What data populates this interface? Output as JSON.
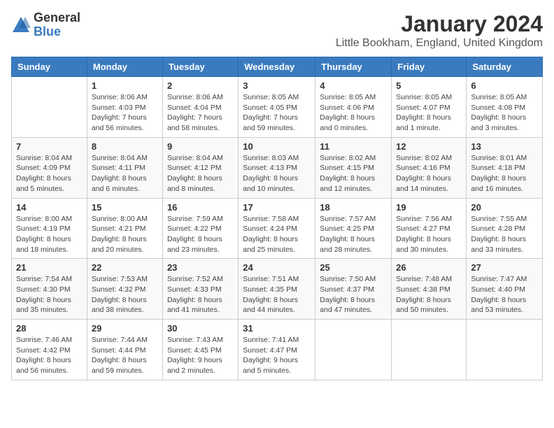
{
  "logo": {
    "general": "General",
    "blue": "Blue"
  },
  "title": {
    "month": "January 2024",
    "location": "Little Bookham, England, United Kingdom"
  },
  "headers": [
    "Sunday",
    "Monday",
    "Tuesday",
    "Wednesday",
    "Thursday",
    "Friday",
    "Saturday"
  ],
  "weeks": [
    [
      {
        "day": "",
        "detail": ""
      },
      {
        "day": "1",
        "detail": "Sunrise: 8:06 AM\nSunset: 4:03 PM\nDaylight: 7 hours\nand 56 minutes."
      },
      {
        "day": "2",
        "detail": "Sunrise: 8:06 AM\nSunset: 4:04 PM\nDaylight: 7 hours\nand 58 minutes."
      },
      {
        "day": "3",
        "detail": "Sunrise: 8:05 AM\nSunset: 4:05 PM\nDaylight: 7 hours\nand 59 minutes."
      },
      {
        "day": "4",
        "detail": "Sunrise: 8:05 AM\nSunset: 4:06 PM\nDaylight: 8 hours\nand 0 minutes."
      },
      {
        "day": "5",
        "detail": "Sunrise: 8:05 AM\nSunset: 4:07 PM\nDaylight: 8 hours\nand 1 minute."
      },
      {
        "day": "6",
        "detail": "Sunrise: 8:05 AM\nSunset: 4:08 PM\nDaylight: 8 hours\nand 3 minutes."
      }
    ],
    [
      {
        "day": "7",
        "detail": "Sunrise: 8:04 AM\nSunset: 4:09 PM\nDaylight: 8 hours\nand 5 minutes."
      },
      {
        "day": "8",
        "detail": "Sunrise: 8:04 AM\nSunset: 4:11 PM\nDaylight: 8 hours\nand 6 minutes."
      },
      {
        "day": "9",
        "detail": "Sunrise: 8:04 AM\nSunset: 4:12 PM\nDaylight: 8 hours\nand 8 minutes."
      },
      {
        "day": "10",
        "detail": "Sunrise: 8:03 AM\nSunset: 4:13 PM\nDaylight: 8 hours\nand 10 minutes."
      },
      {
        "day": "11",
        "detail": "Sunrise: 8:02 AM\nSunset: 4:15 PM\nDaylight: 8 hours\nand 12 minutes."
      },
      {
        "day": "12",
        "detail": "Sunrise: 8:02 AM\nSunset: 4:16 PM\nDaylight: 8 hours\nand 14 minutes."
      },
      {
        "day": "13",
        "detail": "Sunrise: 8:01 AM\nSunset: 4:18 PM\nDaylight: 8 hours\nand 16 minutes."
      }
    ],
    [
      {
        "day": "14",
        "detail": "Sunrise: 8:00 AM\nSunset: 4:19 PM\nDaylight: 8 hours\nand 18 minutes."
      },
      {
        "day": "15",
        "detail": "Sunrise: 8:00 AM\nSunset: 4:21 PM\nDaylight: 8 hours\nand 20 minutes."
      },
      {
        "day": "16",
        "detail": "Sunrise: 7:59 AM\nSunset: 4:22 PM\nDaylight: 8 hours\nand 23 minutes."
      },
      {
        "day": "17",
        "detail": "Sunrise: 7:58 AM\nSunset: 4:24 PM\nDaylight: 8 hours\nand 25 minutes."
      },
      {
        "day": "18",
        "detail": "Sunrise: 7:57 AM\nSunset: 4:25 PM\nDaylight: 8 hours\nand 28 minutes."
      },
      {
        "day": "19",
        "detail": "Sunrise: 7:56 AM\nSunset: 4:27 PM\nDaylight: 8 hours\nand 30 minutes."
      },
      {
        "day": "20",
        "detail": "Sunrise: 7:55 AM\nSunset: 4:28 PM\nDaylight: 8 hours\nand 33 minutes."
      }
    ],
    [
      {
        "day": "21",
        "detail": "Sunrise: 7:54 AM\nSunset: 4:30 PM\nDaylight: 8 hours\nand 35 minutes."
      },
      {
        "day": "22",
        "detail": "Sunrise: 7:53 AM\nSunset: 4:32 PM\nDaylight: 8 hours\nand 38 minutes."
      },
      {
        "day": "23",
        "detail": "Sunrise: 7:52 AM\nSunset: 4:33 PM\nDaylight: 8 hours\nand 41 minutes."
      },
      {
        "day": "24",
        "detail": "Sunrise: 7:51 AM\nSunset: 4:35 PM\nDaylight: 8 hours\nand 44 minutes."
      },
      {
        "day": "25",
        "detail": "Sunrise: 7:50 AM\nSunset: 4:37 PM\nDaylight: 8 hours\nand 47 minutes."
      },
      {
        "day": "26",
        "detail": "Sunrise: 7:48 AM\nSunset: 4:38 PM\nDaylight: 8 hours\nand 50 minutes."
      },
      {
        "day": "27",
        "detail": "Sunrise: 7:47 AM\nSunset: 4:40 PM\nDaylight: 8 hours\nand 53 minutes."
      }
    ],
    [
      {
        "day": "28",
        "detail": "Sunrise: 7:46 AM\nSunset: 4:42 PM\nDaylight: 8 hours\nand 56 minutes."
      },
      {
        "day": "29",
        "detail": "Sunrise: 7:44 AM\nSunset: 4:44 PM\nDaylight: 8 hours\nand 59 minutes."
      },
      {
        "day": "30",
        "detail": "Sunrise: 7:43 AM\nSunset: 4:45 PM\nDaylight: 9 hours\nand 2 minutes."
      },
      {
        "day": "31",
        "detail": "Sunrise: 7:41 AM\nSunset: 4:47 PM\nDaylight: 9 hours\nand 5 minutes."
      },
      {
        "day": "",
        "detail": ""
      },
      {
        "day": "",
        "detail": ""
      },
      {
        "day": "",
        "detail": ""
      }
    ]
  ]
}
